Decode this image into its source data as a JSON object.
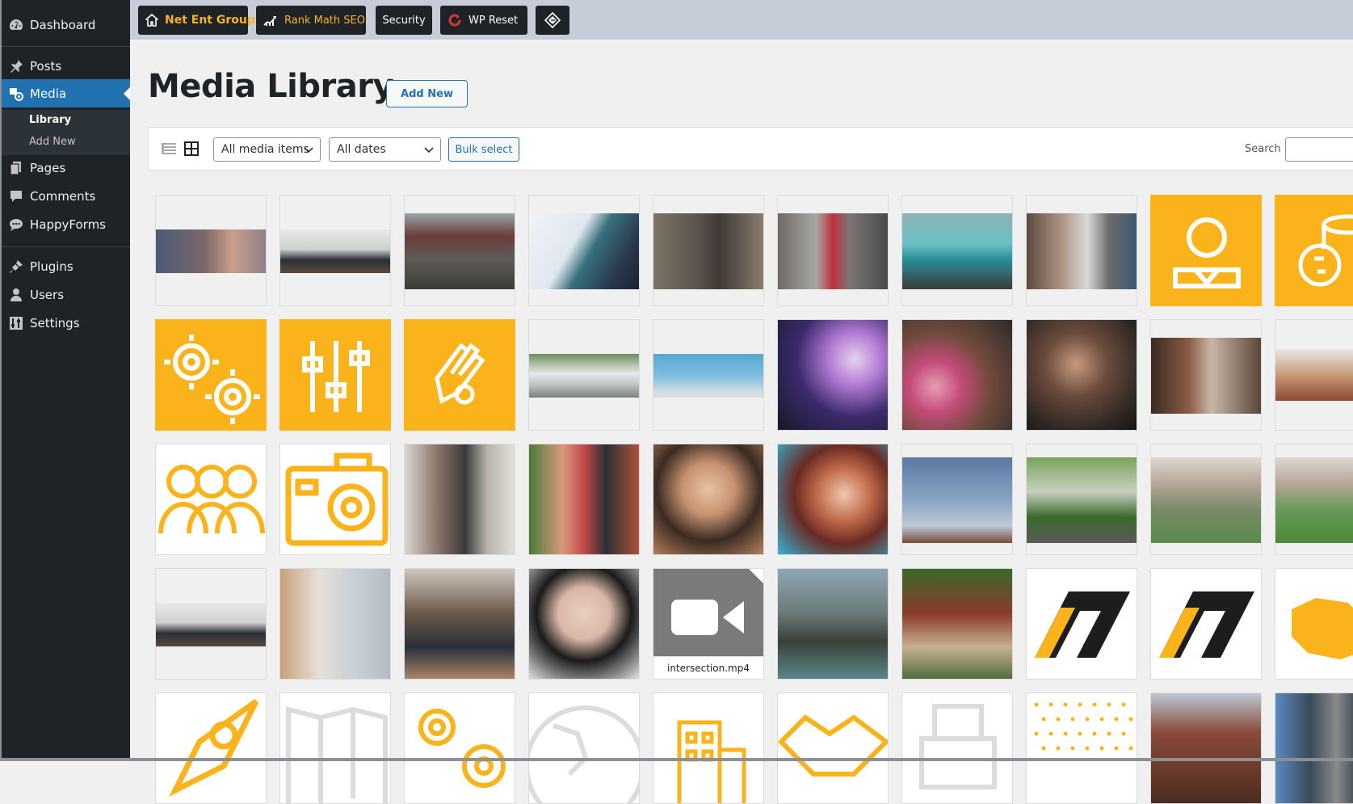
{
  "sidebar": {
    "items": [
      {
        "label": "Dashboard",
        "icon": "dashboard-icon"
      },
      {
        "label": "Posts",
        "icon": "pin-icon"
      },
      {
        "label": "Media",
        "icon": "media-icon"
      },
      {
        "label": "Pages",
        "icon": "pages-icon"
      },
      {
        "label": "Comments",
        "icon": "comment-icon"
      },
      {
        "label": "HappyForms",
        "icon": "chat-icon"
      },
      {
        "label": "Plugins",
        "icon": "plugin-icon"
      },
      {
        "label": "Users",
        "icon": "user-icon"
      },
      {
        "label": "Settings",
        "icon": "settings-icon"
      }
    ],
    "media_submenu": [
      "Library",
      "Add New"
    ]
  },
  "topbar": {
    "buttons": [
      {
        "label": "Net Ent Group",
        "icon": "home-icon"
      },
      {
        "label": "Rank Math SEO",
        "icon": "chart-icon"
      },
      {
        "label": "Security",
        "icon": ""
      },
      {
        "label": "WP Reset",
        "icon": "reset-icon"
      },
      {
        "label": "",
        "icon": "diamond-icon"
      }
    ]
  },
  "page": {
    "title": "Media Library",
    "add_new": "Add New"
  },
  "filters": {
    "media_type": "All media items",
    "dates": "All dates",
    "bulk_select": "Bulk select",
    "search_label": "Search",
    "search_value": ""
  },
  "media_grid": {
    "video_caption": "intersection.mp4"
  },
  "colors": {
    "accent": "#2271b1",
    "sidebar_bg": "#1d2327",
    "brand_orange": "#fbb31b"
  }
}
